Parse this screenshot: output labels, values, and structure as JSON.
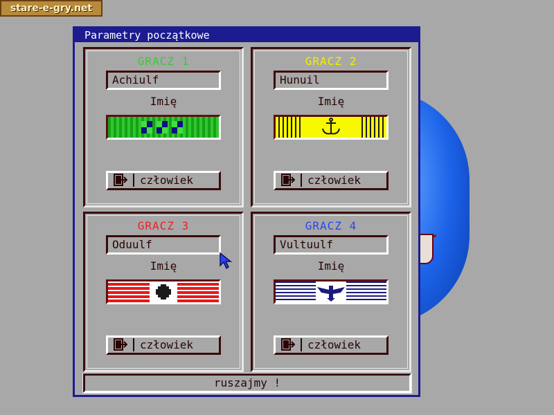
{
  "watermark": "stare-e-gry.net",
  "dialog": {
    "title": "Parametry początkowe",
    "start_label": "ruszajmy !"
  },
  "players": [
    {
      "title": "GRACZ 1",
      "name": "Achiulf",
      "name_label": "Imię",
      "type": "człowiek",
      "color": "#3cc83c"
    },
    {
      "title": "GRACZ 2",
      "name": "Hunuil",
      "name_label": "Imię",
      "type": "człowiek",
      "color": "#f0f000"
    },
    {
      "title": "GRACZ 3",
      "name": "Oduulf",
      "name_label": "Imię",
      "type": "człowiek",
      "color": "#f02020"
    },
    {
      "title": "GRACZ 4",
      "name": "Vultuulf",
      "name_label": "Imię",
      "type": "człowiek",
      "color": "#2a44f0"
    }
  ],
  "icons": [
    "player-type-toggle-icon",
    "anchor-icon",
    "cross-emblem-icon",
    "eagle-emblem-icon",
    "mouse-cursor-icon"
  ]
}
